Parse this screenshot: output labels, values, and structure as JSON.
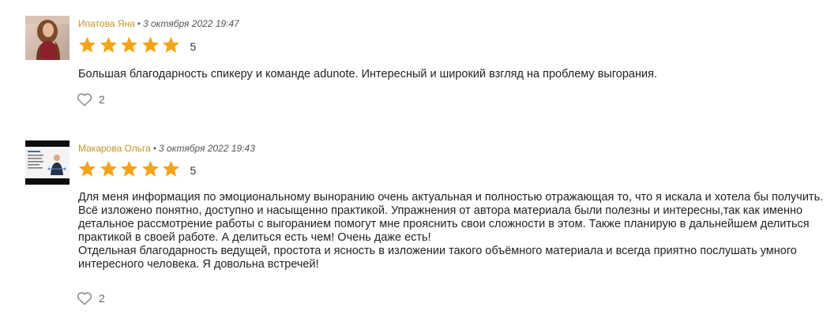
{
  "reviews": [
    {
      "author": "Ипатова Яна",
      "separator": "•",
      "date": "3 октября 2022 19:47",
      "rating": "5",
      "stars_filled": 5,
      "text": "Большая благодарность спикеру и команде adunote. Интересный и широкий взгляд на проблему выгорания.",
      "likes": "2"
    },
    {
      "author": "Макарова Ольга",
      "separator": "•",
      "date": "3 октября 2022 19:43",
      "rating": "5",
      "stars_filled": 5,
      "text": "Для меня информация по эмоциональному выноранию очень актуальная и полностью отражающая то, что я искала и хотела бы получить. Всё изложено понятно, доступно и насыщенно практикой. Упражнения от автора материала были полезны и интересны,так как именно детальное рассмотрение работы с выгоранием помогут мне прояснить свои сложности в этом. Также планирую в дальнейшем делиться практикой в своей работе. А делиться есть чем! Очень даже есть!\nОтдельная благодарность ведущей, простота и ясность в изложении такого объёмного материала и всегда приятно послушать умного интересного человека. Я довольна встречей!",
      "likes": "2"
    }
  ],
  "colors": {
    "author": "#c79327",
    "star": "#f4a418",
    "text": "#222222",
    "heart_stroke": "#888888"
  },
  "icons": {
    "star": "star-icon",
    "heart": "heart-icon"
  }
}
